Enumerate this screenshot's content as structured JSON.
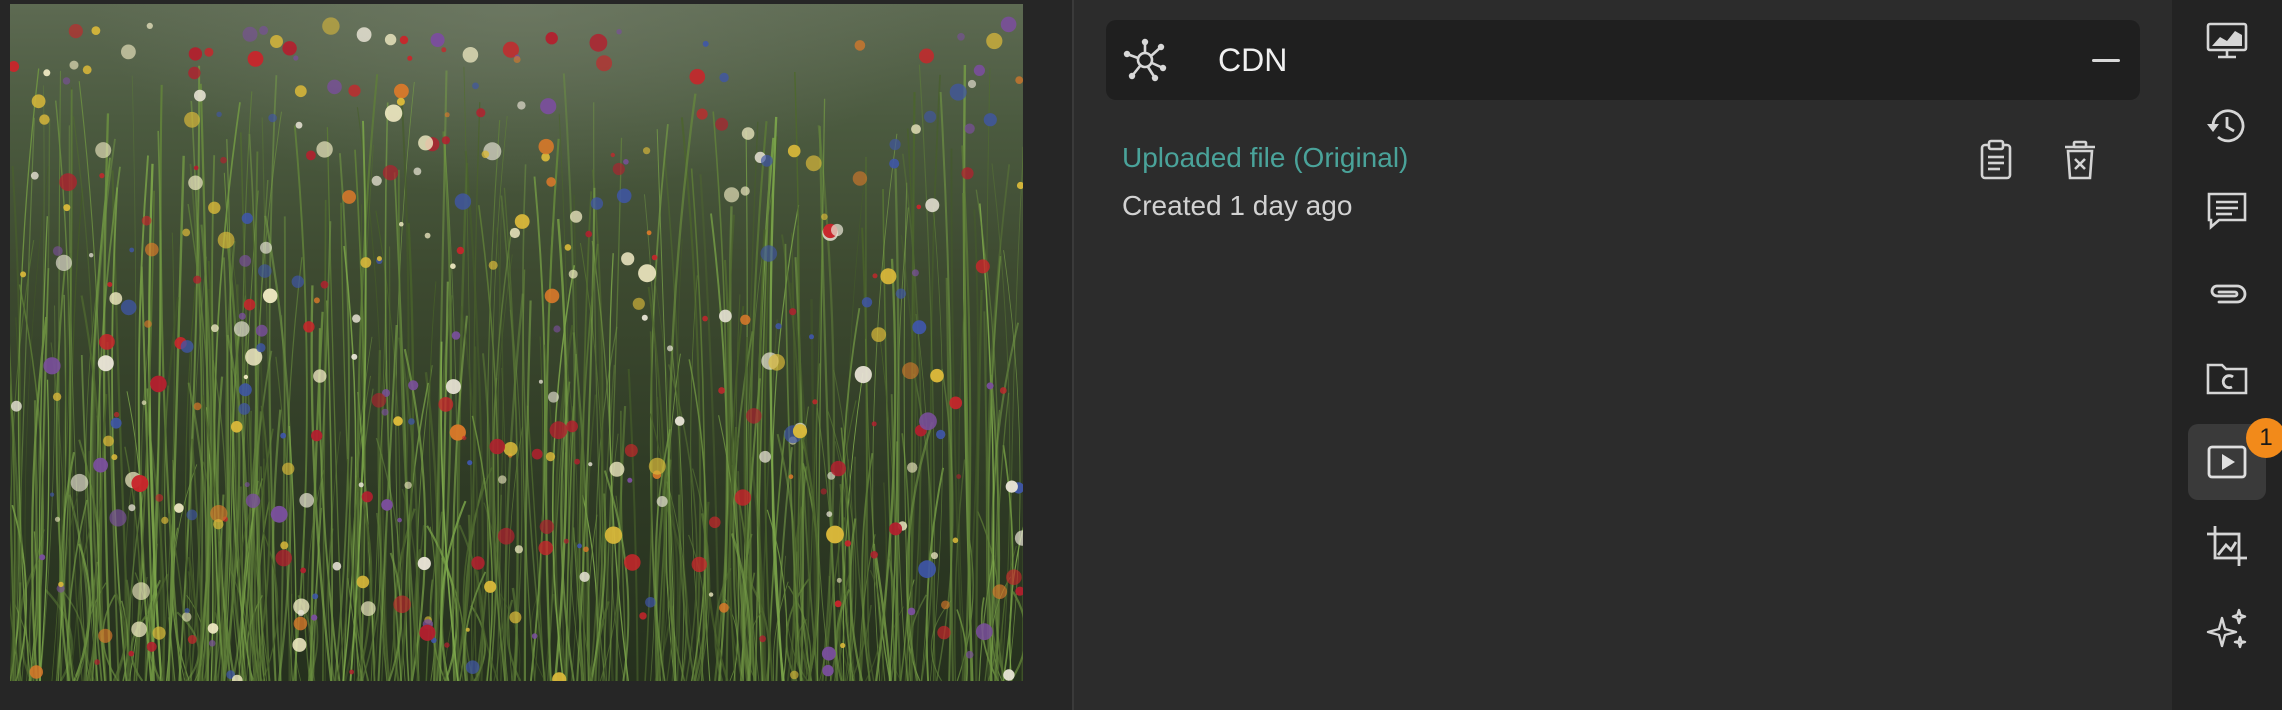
{
  "preview": {
    "image_alt": "wildflower-meadow-photo"
  },
  "panel": {
    "section_title": "CDN",
    "file": {
      "link_text": "Uploaded file (Original)",
      "created_text": "Created 1 day ago"
    }
  },
  "toolbar": {
    "items": [
      {
        "icon": "presentation-chart-icon"
      },
      {
        "icon": "history-icon"
      },
      {
        "icon": "comments-icon"
      },
      {
        "icon": "attachment-icon"
      },
      {
        "icon": "folder-c-icon"
      },
      {
        "icon": "video-play-icon",
        "badge": "1",
        "active": true
      },
      {
        "icon": "crop-image-icon"
      },
      {
        "icon": "ai-sparkle-icon"
      }
    ]
  },
  "colors": {
    "accent_link": "#4aa39a",
    "badge": "#f28a1a",
    "background": "#272727"
  }
}
